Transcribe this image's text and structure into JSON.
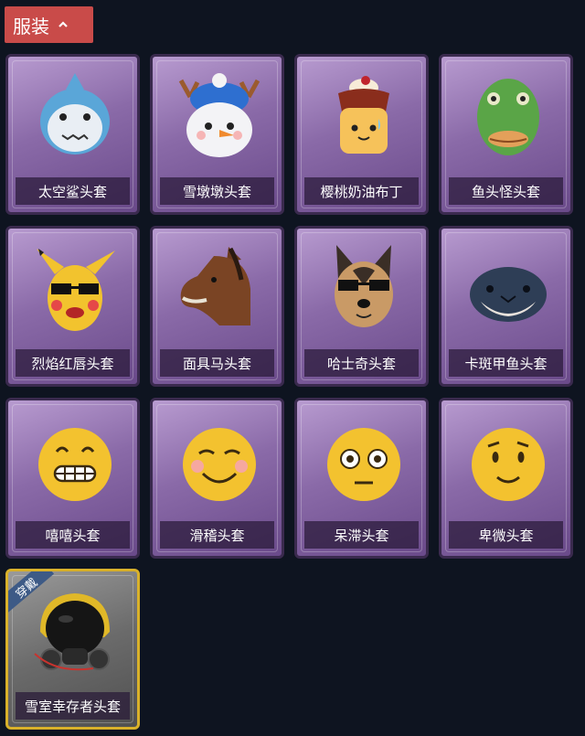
{
  "category": {
    "label": "服装"
  },
  "items": [
    {
      "label": "太空鲨头套",
      "icon": "space-shark-mask"
    },
    {
      "label": "雪墩墩头套",
      "icon": "snowman-mask"
    },
    {
      "label": "樱桃奶油布丁",
      "icon": "pudding-mask"
    },
    {
      "label": "鱼头怪头套",
      "icon": "fish-head-mask"
    },
    {
      "label": "烈焰红唇头套",
      "icon": "pikachu-mask"
    },
    {
      "label": "面具马头套",
      "icon": "horse-mask"
    },
    {
      "label": "哈士奇头套",
      "icon": "husky-mask"
    },
    {
      "label": "卡斑甲鱼头套",
      "icon": "puffer-mask"
    },
    {
      "label": "嘻嘻头套",
      "icon": "grin-emoji-mask"
    },
    {
      "label": "滑稽头套",
      "icon": "funny-emoji-mask"
    },
    {
      "label": "呆滞头套",
      "icon": "dazed-emoji-mask"
    },
    {
      "label": "卑微头套",
      "icon": "humble-emoji-mask"
    },
    {
      "label": "雪室幸存者头套",
      "icon": "gas-mask-helmet",
      "badge": "穿戴"
    }
  ],
  "colors": {
    "tab": "#c94b49",
    "background": "#0e1420",
    "equipped_border": "#d9b12a"
  }
}
